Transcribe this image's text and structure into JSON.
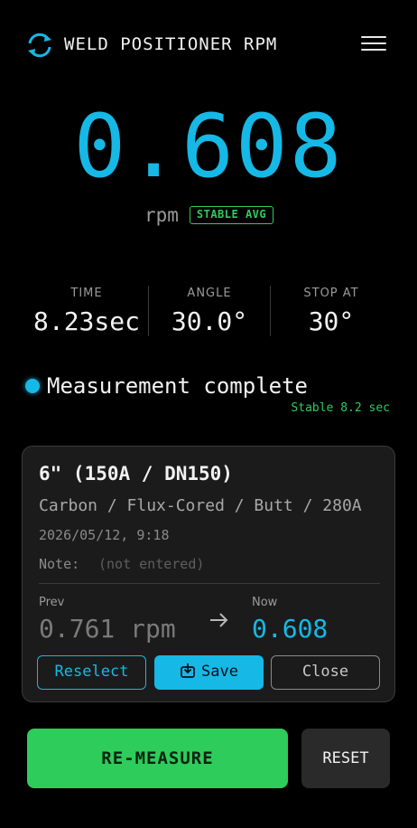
{
  "header": {
    "title": "WELD POSITIONER RPM",
    "sync_icon": "sync-icon",
    "menu_icon": "hamburger-menu-icon"
  },
  "reading": {
    "value": "0.608",
    "unit": "rpm",
    "badge": "STABLE AVG"
  },
  "stats": [
    {
      "label": "TIME",
      "value": "8.23sec"
    },
    {
      "label": "ANGLE",
      "value": "30.0°"
    },
    {
      "label": "STOP AT",
      "value": "30°"
    }
  ],
  "status": {
    "text": "Measurement complete",
    "sub": "Stable 8.2 sec"
  },
  "card": {
    "title": "6\" (150A / DN150)",
    "spec": "Carbon / Flux-Cored / Butt / 280A",
    "date": "2026/05/12, 9:18",
    "note_label": "Note:",
    "note_value": "(not entered)",
    "prev_label": "Prev",
    "prev_value": "0.761 rpm",
    "now_label": "Now",
    "now_value": "0.608",
    "buttons": {
      "reselect": "Reselect",
      "save": "Save",
      "close": "Close"
    }
  },
  "actions": {
    "remeasure": "RE-MEASURE",
    "reset": "RESET"
  },
  "colors": {
    "accent": "#16b8e6",
    "success": "#2ecc5a",
    "background": "#000000",
    "card": "#1b1b1b"
  }
}
